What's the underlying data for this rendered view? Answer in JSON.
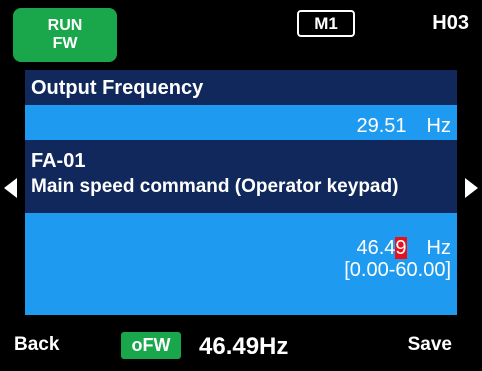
{
  "status": {
    "run_line1": "RUN",
    "run_line2": "FW",
    "mode": "M1",
    "screen_code": "H03"
  },
  "monitor": {
    "title": "Output Frequency",
    "value": "29.51",
    "unit": "Hz"
  },
  "parameter": {
    "code": "FA-01",
    "description": "Main speed command (Operator keypad)",
    "value_prefix": "46.4",
    "value_cursor_digit": "9",
    "unit": "Hz",
    "range": "[0.00-60.00]"
  },
  "bottom": {
    "back_label": "Back",
    "direction_label": "oFW",
    "frequency_readout": "46.49Hz",
    "save_label": "Save"
  },
  "colors": {
    "background": "#000000",
    "panel_dark": "#10285c",
    "panel_light": "#1e9bf0",
    "status_green": "#1aa64a",
    "cursor_red": "#e8101a"
  }
}
